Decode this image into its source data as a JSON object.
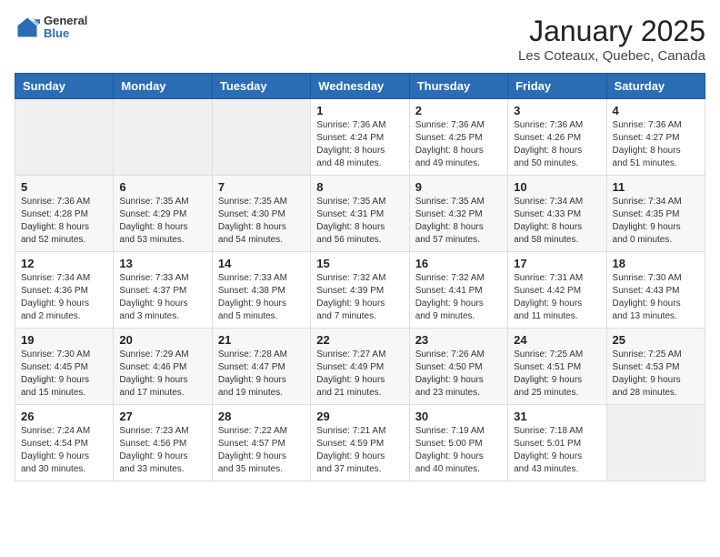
{
  "header": {
    "logo": {
      "line1": "General",
      "line2": "Blue"
    },
    "title": "January 2025",
    "subtitle": "Les Coteaux, Quebec, Canada"
  },
  "days_of_week": [
    "Sunday",
    "Monday",
    "Tuesday",
    "Wednesday",
    "Thursday",
    "Friday",
    "Saturday"
  ],
  "weeks": [
    [
      {
        "day": "",
        "info": ""
      },
      {
        "day": "",
        "info": ""
      },
      {
        "day": "",
        "info": ""
      },
      {
        "day": "1",
        "info": "Sunrise: 7:36 AM\nSunset: 4:24 PM\nDaylight: 8 hours\nand 48 minutes."
      },
      {
        "day": "2",
        "info": "Sunrise: 7:36 AM\nSunset: 4:25 PM\nDaylight: 8 hours\nand 49 minutes."
      },
      {
        "day": "3",
        "info": "Sunrise: 7:36 AM\nSunset: 4:26 PM\nDaylight: 8 hours\nand 50 minutes."
      },
      {
        "day": "4",
        "info": "Sunrise: 7:36 AM\nSunset: 4:27 PM\nDaylight: 8 hours\nand 51 minutes."
      }
    ],
    [
      {
        "day": "5",
        "info": "Sunrise: 7:36 AM\nSunset: 4:28 PM\nDaylight: 8 hours\nand 52 minutes."
      },
      {
        "day": "6",
        "info": "Sunrise: 7:35 AM\nSunset: 4:29 PM\nDaylight: 8 hours\nand 53 minutes."
      },
      {
        "day": "7",
        "info": "Sunrise: 7:35 AM\nSunset: 4:30 PM\nDaylight: 8 hours\nand 54 minutes."
      },
      {
        "day": "8",
        "info": "Sunrise: 7:35 AM\nSunset: 4:31 PM\nDaylight: 8 hours\nand 56 minutes."
      },
      {
        "day": "9",
        "info": "Sunrise: 7:35 AM\nSunset: 4:32 PM\nDaylight: 8 hours\nand 57 minutes."
      },
      {
        "day": "10",
        "info": "Sunrise: 7:34 AM\nSunset: 4:33 PM\nDaylight: 8 hours\nand 58 minutes."
      },
      {
        "day": "11",
        "info": "Sunrise: 7:34 AM\nSunset: 4:35 PM\nDaylight: 9 hours\nand 0 minutes."
      }
    ],
    [
      {
        "day": "12",
        "info": "Sunrise: 7:34 AM\nSunset: 4:36 PM\nDaylight: 9 hours\nand 2 minutes."
      },
      {
        "day": "13",
        "info": "Sunrise: 7:33 AM\nSunset: 4:37 PM\nDaylight: 9 hours\nand 3 minutes."
      },
      {
        "day": "14",
        "info": "Sunrise: 7:33 AM\nSunset: 4:38 PM\nDaylight: 9 hours\nand 5 minutes."
      },
      {
        "day": "15",
        "info": "Sunrise: 7:32 AM\nSunset: 4:39 PM\nDaylight: 9 hours\nand 7 minutes."
      },
      {
        "day": "16",
        "info": "Sunrise: 7:32 AM\nSunset: 4:41 PM\nDaylight: 9 hours\nand 9 minutes."
      },
      {
        "day": "17",
        "info": "Sunrise: 7:31 AM\nSunset: 4:42 PM\nDaylight: 9 hours\nand 11 minutes."
      },
      {
        "day": "18",
        "info": "Sunrise: 7:30 AM\nSunset: 4:43 PM\nDaylight: 9 hours\nand 13 minutes."
      }
    ],
    [
      {
        "day": "19",
        "info": "Sunrise: 7:30 AM\nSunset: 4:45 PM\nDaylight: 9 hours\nand 15 minutes."
      },
      {
        "day": "20",
        "info": "Sunrise: 7:29 AM\nSunset: 4:46 PM\nDaylight: 9 hours\nand 17 minutes."
      },
      {
        "day": "21",
        "info": "Sunrise: 7:28 AM\nSunset: 4:47 PM\nDaylight: 9 hours\nand 19 minutes."
      },
      {
        "day": "22",
        "info": "Sunrise: 7:27 AM\nSunset: 4:49 PM\nDaylight: 9 hours\nand 21 minutes."
      },
      {
        "day": "23",
        "info": "Sunrise: 7:26 AM\nSunset: 4:50 PM\nDaylight: 9 hours\nand 23 minutes."
      },
      {
        "day": "24",
        "info": "Sunrise: 7:25 AM\nSunset: 4:51 PM\nDaylight: 9 hours\nand 25 minutes."
      },
      {
        "day": "25",
        "info": "Sunrise: 7:25 AM\nSunset: 4:53 PM\nDaylight: 9 hours\nand 28 minutes."
      }
    ],
    [
      {
        "day": "26",
        "info": "Sunrise: 7:24 AM\nSunset: 4:54 PM\nDaylight: 9 hours\nand 30 minutes."
      },
      {
        "day": "27",
        "info": "Sunrise: 7:23 AM\nSunset: 4:56 PM\nDaylight: 9 hours\nand 33 minutes."
      },
      {
        "day": "28",
        "info": "Sunrise: 7:22 AM\nSunset: 4:57 PM\nDaylight: 9 hours\nand 35 minutes."
      },
      {
        "day": "29",
        "info": "Sunrise: 7:21 AM\nSunset: 4:59 PM\nDaylight: 9 hours\nand 37 minutes."
      },
      {
        "day": "30",
        "info": "Sunrise: 7:19 AM\nSunset: 5:00 PM\nDaylight: 9 hours\nand 40 minutes."
      },
      {
        "day": "31",
        "info": "Sunrise: 7:18 AM\nSunset: 5:01 PM\nDaylight: 9 hours\nand 43 minutes."
      },
      {
        "day": "",
        "info": ""
      }
    ]
  ]
}
